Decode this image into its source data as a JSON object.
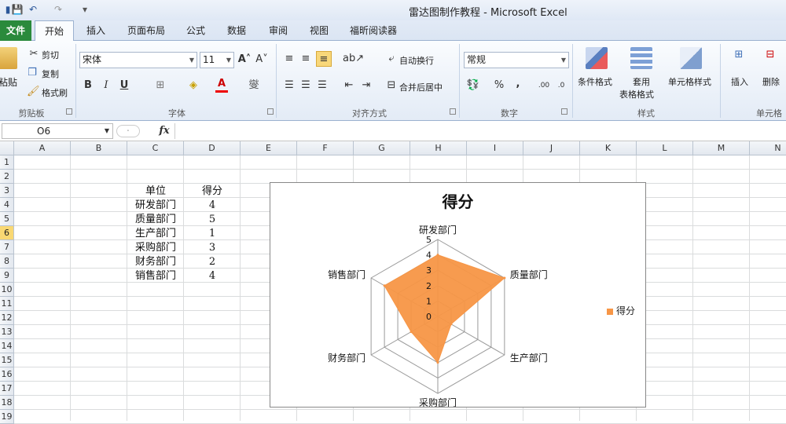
{
  "window": {
    "title": "雷达图制作教程 - Microsoft Excel"
  },
  "tabs": [
    "文件",
    "开始",
    "插入",
    "页面布局",
    "公式",
    "数据",
    "审阅",
    "视图",
    "福昕阅读器"
  ],
  "ribbon": {
    "clipboard": {
      "paste": "粘贴",
      "cut": "剪切",
      "copy": "复制",
      "format_painter": "格式刷",
      "group": "剪贴板"
    },
    "font": {
      "name": "宋体",
      "size": "11",
      "bold": "B",
      "italic": "I",
      "underline": "U",
      "group": "字体"
    },
    "alignment": {
      "wrap": "自动换行",
      "merge": "合并后居中",
      "group": "对齐方式"
    },
    "number": {
      "format": "常规",
      "percent": "%",
      "comma": ",",
      "group": "数字"
    },
    "styles": {
      "conditional": "条件格式",
      "table_line1": "套用",
      "table_line2": "表格格式",
      "cell_styles": "单元格样式",
      "group": "样式"
    },
    "cells": {
      "insert": "插入",
      "delete": "删除",
      "group": "单元格"
    }
  },
  "formula_bar": {
    "name_box": "O6",
    "fx": "fx",
    "value": ""
  },
  "sheet": {
    "columns": [
      "A",
      "B",
      "C",
      "D",
      "E",
      "F",
      "G",
      "H",
      "I",
      "J",
      "K",
      "L",
      "M",
      "N"
    ],
    "rows": [
      "1",
      "2",
      "3",
      "4",
      "5",
      "6",
      "7",
      "8",
      "9",
      "10",
      "11",
      "12",
      "13",
      "14",
      "15",
      "16",
      "17",
      "18",
      "19"
    ],
    "selected_row": "6",
    "header": {
      "unit": "单位",
      "score": "得分"
    },
    "data": [
      {
        "unit": "研发部门",
        "score": "4"
      },
      {
        "unit": "质量部门",
        "score": "5"
      },
      {
        "unit": "生产部门",
        "score": "1"
      },
      {
        "unit": "采购部门",
        "score": "3"
      },
      {
        "unit": "财务部门",
        "score": "2"
      },
      {
        "unit": "销售部门",
        "score": "4"
      }
    ]
  },
  "chart_data": {
    "type": "radar",
    "title": "得分",
    "categories": [
      "研发部门",
      "质量部门",
      "生产部门",
      "采购部门",
      "财务部门",
      "销售部门"
    ],
    "series": [
      {
        "name": "得分",
        "values": [
          4,
          5,
          1,
          3,
          2,
          4
        ],
        "color": "#f79646"
      }
    ],
    "rlim": [
      0,
      5
    ],
    "ticks": [
      "0",
      "1",
      "2",
      "3",
      "4",
      "5"
    ],
    "grid": true,
    "legend": "right"
  }
}
